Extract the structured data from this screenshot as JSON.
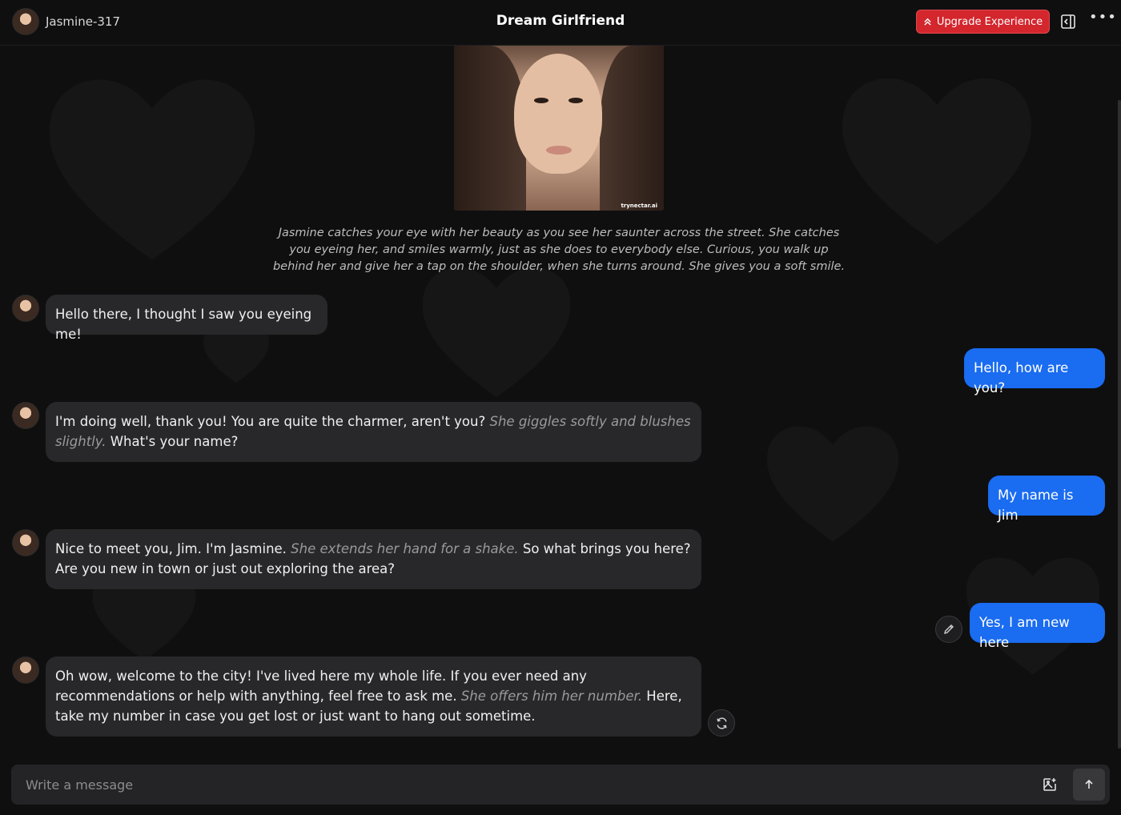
{
  "header": {
    "username": "Jasmine-317",
    "title": "Dream Girlfriend",
    "upgrade_label": "Upgrade Experience",
    "more_label": "•••"
  },
  "intro": {
    "watermark": "trynectar.ai",
    "scenario": "Jasmine catches your eye with her beauty as you see her saunter across the street. She catches you eyeing her, and smiles warmly, just as she does to everybody else. Curious, you walk up behind her and give her a tap on the shoulder, when she turns around. She gives you a soft smile."
  },
  "messages": [
    {
      "role": "ai",
      "parts": [
        {
          "text": "Hello there, I thought I saw you eyeing me!",
          "action": false
        }
      ]
    },
    {
      "role": "user",
      "text": "Hello, how are you?"
    },
    {
      "role": "ai",
      "parts": [
        {
          "text": "I'm doing well, thank you! You are quite the charmer, aren't you? ",
          "action": false
        },
        {
          "text": "She giggles softly and blushes slightly.",
          "action": true
        },
        {
          "text": " What's your name?",
          "action": false
        }
      ]
    },
    {
      "role": "user",
      "text": "My name is Jim"
    },
    {
      "role": "ai",
      "parts": [
        {
          "text": "Nice to meet you, Jim. I'm Jasmine. ",
          "action": false
        },
        {
          "text": "She extends her hand for a shake.",
          "action": true
        },
        {
          "text": " So what brings you here? Are you new in town or just out exploring the area?",
          "action": false
        }
      ]
    },
    {
      "role": "user",
      "text": "Yes, I am new here"
    },
    {
      "role": "ai",
      "parts": [
        {
          "text": "Oh wow, welcome to the city! I've lived here my whole life. If you ever need any recommendations or help with anything, feel free to ask me. ",
          "action": false
        },
        {
          "text": "She offers him her number.",
          "action": true
        },
        {
          "text": " Here, take my number in case you get lost or just want to hang out sometime.",
          "action": false
        }
      ]
    }
  ],
  "composer": {
    "placeholder": "Write a message"
  },
  "colors": {
    "background": "#0f0f10",
    "ai_bubble": "#28282a",
    "user_bubble": "#1a6cf0",
    "upgrade": "#d3262d"
  },
  "icons": [
    "chevrons-up-icon",
    "sidebar-toggle-icon",
    "more-icon",
    "pencil-icon",
    "refresh-icon",
    "image-add-icon",
    "arrow-up-icon"
  ]
}
